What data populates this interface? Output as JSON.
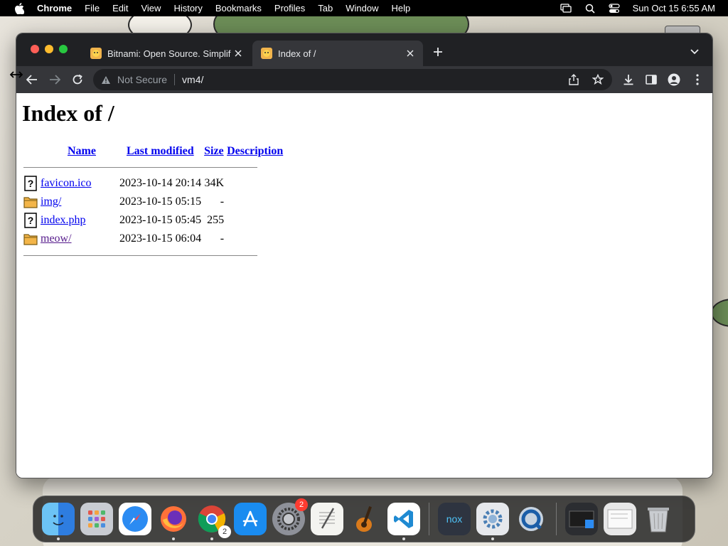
{
  "menubar": {
    "app": "Chrome",
    "items": [
      "File",
      "Edit",
      "View",
      "History",
      "Bookmarks",
      "Profiles",
      "Tab",
      "Window",
      "Help"
    ],
    "clock": "Sun Oct 15  6:55 AM"
  },
  "browser": {
    "tabs": [
      {
        "title": "Bitnami: Open Source. Simplif",
        "active": false
      },
      {
        "title": "Index of /",
        "active": true
      }
    ],
    "omnibox": {
      "security": "Not Secure",
      "url": "vm4/"
    }
  },
  "page": {
    "heading": "Index of /",
    "columns": {
      "name": "Name",
      "modified": "Last modified",
      "size": "Size",
      "description": "Description"
    },
    "rows": [
      {
        "icon": "unknown-file-icon",
        "name": "favicon.ico",
        "modified": "2023-10-14 20:14",
        "size": "34K",
        "description": ""
      },
      {
        "icon": "folder-icon",
        "name": "img/",
        "modified": "2023-10-15 05:15",
        "size": "-",
        "description": ""
      },
      {
        "icon": "unknown-file-icon",
        "name": "index.php",
        "modified": "2023-10-15 05:45",
        "size": "255",
        "description": ""
      },
      {
        "icon": "folder-icon",
        "name": "meow/",
        "modified": "2023-10-15 06:04",
        "size": "-",
        "description": ""
      }
    ]
  },
  "dock": {
    "apps": [
      "finder-icon",
      "launchpad-icon",
      "safari-icon",
      "firefox-icon",
      "chrome-icon",
      "app-store-icon",
      "system-settings-icon",
      "textedit-icon",
      "garageband-icon",
      "vscode-icon",
      "nox-icon",
      "settings-gear-icon",
      "quicktime-icon"
    ],
    "badges": {
      "system-settings-icon": "2",
      "chrome-icon": "2"
    }
  },
  "colors": {
    "link": "#0000ee",
    "visited_link": "#551a8b",
    "tab_bg": "#202124",
    "toolbar_bg": "#35363a"
  }
}
